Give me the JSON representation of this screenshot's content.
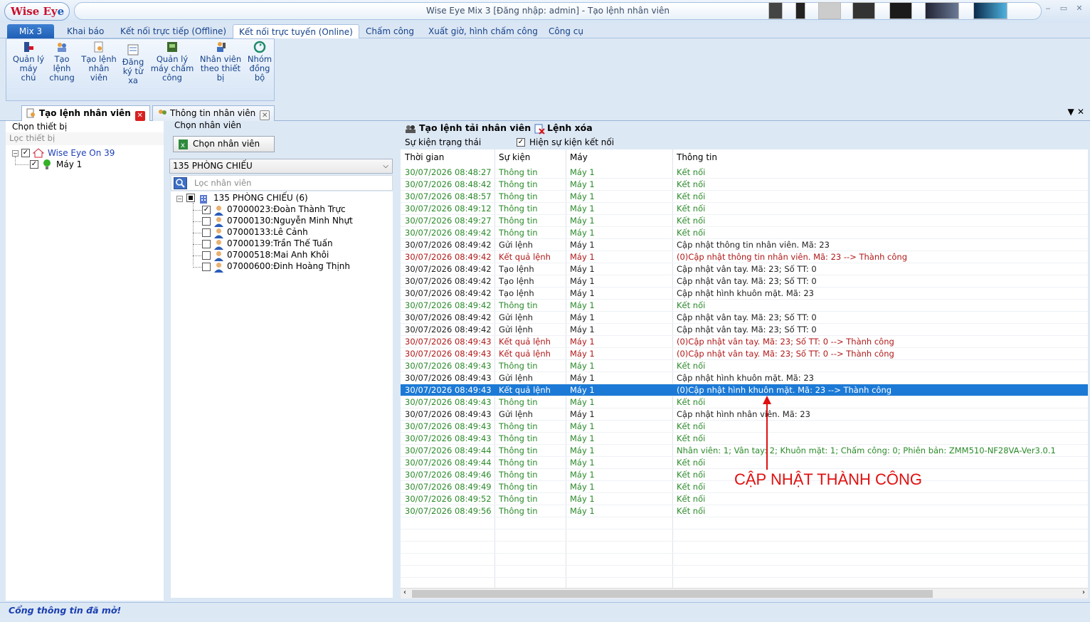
{
  "window": {
    "logo_text": "Wise Ey",
    "logo_accent": "e",
    "title": "Wise Eye Mix 3 [Đăng nhập: admin] - Tạo lệnh nhân viên"
  },
  "menu": {
    "tabs": [
      "Mix 3",
      "Khai báo",
      "Kết nối trực tiếp (Offline)",
      "Kết nối trực tuyến (Online)",
      "Chấm công",
      "Xuất giờ, hình chấm công",
      "Công cụ"
    ]
  },
  "ribbon": {
    "buttons": [
      "Quản lý\nmáy\nchủ",
      "Tạo\nlệnh\nchung",
      "Tạo lệnh\nnhân\nviên",
      "Đăng\nký từ\nxa",
      "Quản lý\nmáy chấm\ncông",
      "Nhân viên\ntheo thiết\nbị",
      "Nhóm\nđồng\nbộ"
    ]
  },
  "doc_tabs": [
    "Tạo lệnh nhân viên",
    "Thông tin nhân viên"
  ],
  "device_panel": {
    "title": "Chọn thiết bị",
    "filter_placeholder": "Lọc thiết bị",
    "root": "Wise Eye On 39",
    "child": "Máy 1"
  },
  "employee_panel": {
    "title": "Chọn nhân viên",
    "select_button": "Chọn nhân viên",
    "department": "135 PHÒNG CHIẾU",
    "filter_placeholder": "Lọc nhân viên",
    "group": "135 PHÒNG CHIẾU (6)",
    "employees": [
      {
        "label": "07000023:Đoàn Thành Trực",
        "checked": true
      },
      {
        "label": "07000130:Nguyễn Minh Nhựt",
        "checked": false
      },
      {
        "label": "07000133:Lê Cảnh",
        "checked": false
      },
      {
        "label": "07000139:Trần Thế Tuấn",
        "checked": false
      },
      {
        "label": "07000518:Mai Anh Khôi",
        "checked": false
      },
      {
        "label": "07000600:Đinh Hoàng Thịnh",
        "checked": false
      }
    ]
  },
  "log_panel": {
    "upload_button": "Tạo lệnh tải nhân viên",
    "delete_button": "Lệnh xóa",
    "status_events_label": "Sự kiện trạng thái",
    "show_connect_label": "Hiện sự kiện kết nối",
    "columns": [
      "Thời gian",
      "Sự kiện",
      "Máy",
      "Thông tin"
    ],
    "rows": [
      {
        "time": "30/07/2026 08:48:27",
        "event": "Thông tin",
        "device": "Máy 1",
        "info": "Kết nối",
        "color": "green"
      },
      {
        "time": "30/07/2026 08:48:42",
        "event": "Thông tin",
        "device": "Máy 1",
        "info": "Kết nối",
        "color": "green"
      },
      {
        "time": "30/07/2026 08:48:57",
        "event": "Thông tin",
        "device": "Máy 1",
        "info": "Kết nối",
        "color": "green"
      },
      {
        "time": "30/07/2026 08:49:12",
        "event": "Thông tin",
        "device": "Máy 1",
        "info": "Kết nối",
        "color": "green"
      },
      {
        "time": "30/07/2026 08:49:27",
        "event": "Thông tin",
        "device": "Máy 1",
        "info": "Kết nối",
        "color": "green"
      },
      {
        "time": "30/07/2026 08:49:42",
        "event": "Thông tin",
        "device": "Máy 1",
        "info": "Kết nối",
        "color": "green"
      },
      {
        "time": "30/07/2026 08:49:42",
        "event": "Gửi lệnh",
        "device": "Máy 1",
        "info": "Cập nhật thông tin nhân viên. Mã: 23",
        "color": "black"
      },
      {
        "time": "30/07/2026 08:49:42",
        "event": "Kết quả lệnh",
        "device": "Máy 1",
        "info": "(0)Cập nhật thông tin nhân viên. Mã: 23 --> Thành công",
        "color": "red"
      },
      {
        "time": "30/07/2026 08:49:42",
        "event": "Tạo lệnh",
        "device": "Máy 1",
        "info": "Cập nhật vân tay. Mã: 23; Số TT: 0",
        "color": "black"
      },
      {
        "time": "30/07/2026 08:49:42",
        "event": "Tạo lệnh",
        "device": "Máy 1",
        "info": "Cập nhật vân tay. Mã: 23; Số TT: 0",
        "color": "black"
      },
      {
        "time": "30/07/2026 08:49:42",
        "event": "Tạo lệnh",
        "device": "Máy 1",
        "info": "Cập nhật hình khuôn mặt. Mã: 23",
        "color": "black"
      },
      {
        "time": "30/07/2026 08:49:42",
        "event": "Thông tin",
        "device": "Máy 1",
        "info": "Kết nối",
        "color": "green"
      },
      {
        "time": "30/07/2026 08:49:42",
        "event": "Gửi lệnh",
        "device": "Máy 1",
        "info": "Cập nhật vân tay. Mã: 23; Số TT: 0",
        "color": "black"
      },
      {
        "time": "30/07/2026 08:49:42",
        "event": "Gửi lệnh",
        "device": "Máy 1",
        "info": "Cập nhật vân tay. Mã: 23; Số TT: 0",
        "color": "black"
      },
      {
        "time": "30/07/2026 08:49:43",
        "event": "Kết quả lệnh",
        "device": "Máy 1",
        "info": "(0)Cập nhật vân tay. Mã: 23; Số TT: 0 --> Thành công",
        "color": "red"
      },
      {
        "time": "30/07/2026 08:49:43",
        "event": "Kết quả lệnh",
        "device": "Máy 1",
        "info": "(0)Cập nhật vân tay. Mã: 23; Số TT: 0 --> Thành công",
        "color": "red"
      },
      {
        "time": "30/07/2026 08:49:43",
        "event": "Thông tin",
        "device": "Máy 1",
        "info": "Kết nối",
        "color": "green"
      },
      {
        "time": "30/07/2026 08:49:43",
        "event": "Gửi lệnh",
        "device": "Máy 1",
        "info": "Cập nhật hình khuôn mặt. Mã: 23",
        "color": "black"
      },
      {
        "time": "30/07/2026 08:49:43",
        "event": "Kết quả lệnh",
        "device": "Máy 1",
        "info": "(0)Cập nhật hình khuôn mặt. Mã: 23 --> Thành công",
        "color": "selected"
      },
      {
        "time": "30/07/2026 08:49:43",
        "event": "Thông tin",
        "device": "Máy 1",
        "info": "Kết nối",
        "color": "green"
      },
      {
        "time": "30/07/2026 08:49:43",
        "event": "Gửi lệnh",
        "device": "Máy 1",
        "info": "Cập nhật hình nhân viên. Mã: 23",
        "color": "black"
      },
      {
        "time": "30/07/2026 08:49:43",
        "event": "Thông tin",
        "device": "Máy 1",
        "info": "Kết nối",
        "color": "green"
      },
      {
        "time": "30/07/2026 08:49:43",
        "event": "Thông tin",
        "device": "Máy 1",
        "info": "Kết nối",
        "color": "green"
      },
      {
        "time": "30/07/2026 08:49:44",
        "event": "Thông tin",
        "device": "Máy 1",
        "info": "Nhân viên: 1; Vân tay: 2; Khuôn mặt: 1; Chấm công: 0; Phiên bản: ZMM510-NF28VA-Ver3.0.1",
        "color": "green"
      },
      {
        "time": "30/07/2026 08:49:44",
        "event": "Thông tin",
        "device": "Máy 1",
        "info": "Kết nối",
        "color": "green"
      },
      {
        "time": "30/07/2026 08:49:46",
        "event": "Thông tin",
        "device": "Máy 1",
        "info": "Kết nối",
        "color": "green"
      },
      {
        "time": "30/07/2026 08:49:49",
        "event": "Thông tin",
        "device": "Máy 1",
        "info": "Kết nối",
        "color": "green"
      },
      {
        "time": "30/07/2026 08:49:52",
        "event": "Thông tin",
        "device": "Máy 1",
        "info": "Kết nối",
        "color": "green"
      },
      {
        "time": "30/07/2026 08:49:56",
        "event": "Thông tin",
        "device": "Máy 1",
        "info": "Kết nối",
        "color": "green"
      }
    ]
  },
  "annotation": "CẬP NHẬT THÀNH CÔNG",
  "status_bar": "Cổng thông tin đã mở!",
  "colors": {
    "green": "#2a8a2a",
    "red": "#b01818",
    "selected": "#1c7ad6",
    "annotation": "#e01010"
  }
}
